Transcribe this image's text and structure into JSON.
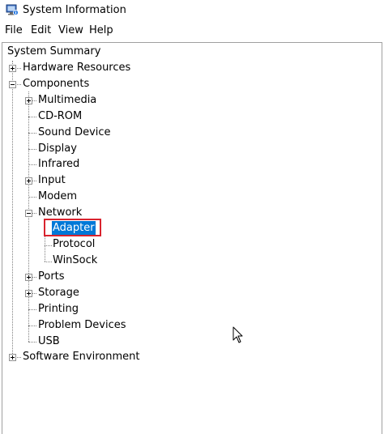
{
  "window": {
    "title": "System Information",
    "icon": "system-information-icon"
  },
  "menu": {
    "items": [
      "File",
      "Edit",
      "View",
      "Help"
    ]
  },
  "tree": {
    "root": "System Summary",
    "hardware_resources": "Hardware Resources",
    "components": "Components",
    "multimedia": "Multimedia",
    "cdrom": "CD-ROM",
    "sound_device": "Sound Device",
    "display": "Display",
    "infrared": "Infrared",
    "input": "Input",
    "modem": "Modem",
    "network": "Network",
    "adapter": "Adapter",
    "protocol": "Protocol",
    "winsock": "WinSock",
    "ports": "Ports",
    "storage": "Storage",
    "printing": "Printing",
    "problem_devices": "Problem Devices",
    "usb": "USB",
    "software_environment": "Software Environment",
    "selected": "Adapter"
  },
  "colors": {
    "selection": "#0078d7",
    "highlight_box": "#d9232e"
  }
}
